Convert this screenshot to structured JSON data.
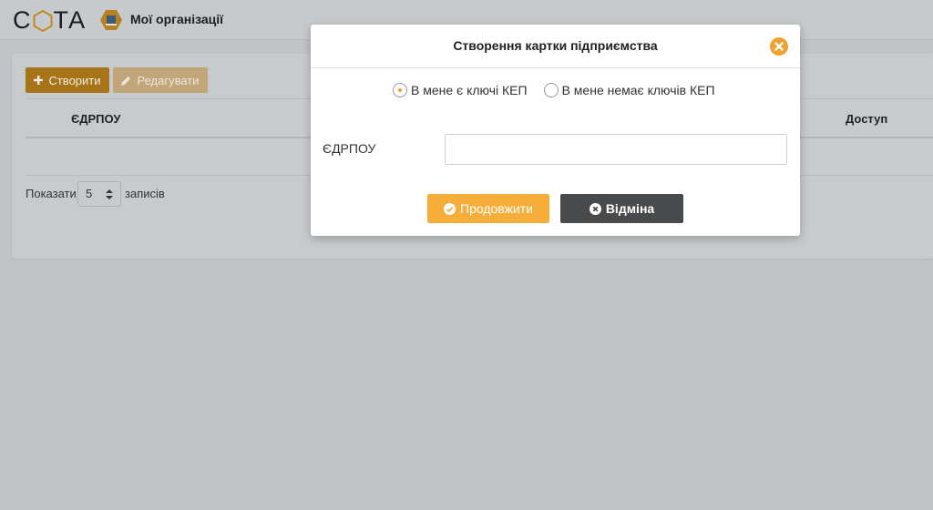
{
  "header": {
    "logo_text": [
      "C",
      "ТА"
    ],
    "nav_title": "Мої організації"
  },
  "toolbar": {
    "create_label": "Створити",
    "edit_label": "Редагувати"
  },
  "table": {
    "columns": [
      "ЄДРПОУ",
      "Доступ"
    ]
  },
  "pagination": {
    "show_label": "Показати",
    "page_size": "5",
    "records_label": "записів"
  },
  "modal": {
    "title": "Створення картки підприємства",
    "radio_options": [
      {
        "label": "В мене є ключі КЕП",
        "checked": true
      },
      {
        "label": "В мене немає ключів КЕП",
        "checked": false
      }
    ],
    "field_label": "ЄДРПОУ",
    "field_value": "",
    "continue_label": "Продовжити",
    "cancel_label": "Відміна"
  },
  "colors": {
    "accent": "#f7ad3a",
    "cancel": "#494a4b",
    "overlay": "#c1c4c7"
  }
}
